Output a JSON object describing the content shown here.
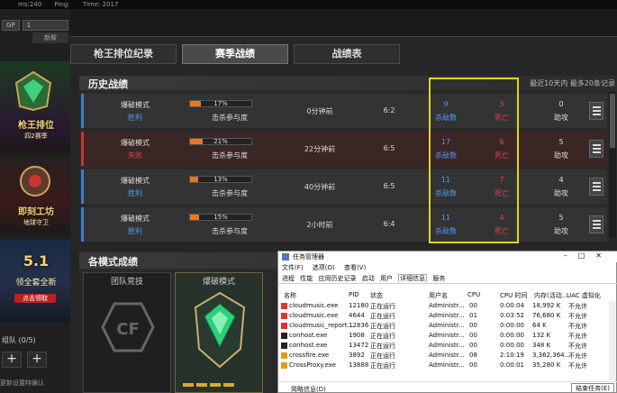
{
  "topbar": {
    "left": "ms:240",
    "ping": "Ping:",
    "time": "Time: 2017"
  },
  "left_sidebar": {
    "gp_label": "GP",
    "gp_value": "1",
    "new_button": "新叙",
    "promo1_title": "枪王排位",
    "promo1_sub": "四2赛季",
    "promo2_title": "即刻工坊",
    "promo2_sub": "地球守卫",
    "promo3_title": "5.1",
    "promo3_sub": "领全套全新",
    "promo3_btn": "点击领取",
    "squad_label": "组队 (0/5)",
    "plus": "+",
    "invite": "更新设置特确认"
  },
  "tabs": [
    {
      "label": "枪王排位纪录",
      "active": false
    },
    {
      "label": "赛季战绩",
      "active": true
    },
    {
      "label": "战绩表",
      "active": false
    }
  ],
  "history": {
    "title": "历史战绩",
    "note": "最近10天内 最多20条记录",
    "participation_label": "击杀参与度",
    "kills_label": "杀敌数",
    "deaths_label": "死亡",
    "assists_label": "助攻",
    "rows": [
      {
        "mode": "爆破模式",
        "result": "胜利",
        "win": true,
        "pct": "17%",
        "pct_value": 17,
        "time": "0分钟前",
        "score": "6:2",
        "kills": "9",
        "deaths": "3",
        "assists": "0"
      },
      {
        "mode": "爆破模式",
        "result": "失败",
        "win": false,
        "pct": "21%",
        "pct_value": 21,
        "time": "22分钟前",
        "score": "6:5",
        "kills": "17",
        "deaths": "6",
        "assists": "5"
      },
      {
        "mode": "爆破模式",
        "result": "胜利",
        "win": true,
        "pct": "13%",
        "pct_value": 13,
        "time": "40分钟前",
        "score": "6:5",
        "kills": "11",
        "deaths": "7",
        "assists": "4"
      },
      {
        "mode": "爆破模式",
        "result": "胜利",
        "win": true,
        "pct": "15%",
        "pct_value": 15,
        "time": "2小时前",
        "score": "6:4",
        "kills": "11",
        "deaths": "4",
        "assists": "5"
      }
    ]
  },
  "modes": {
    "title": "各模式成绩",
    "cards": [
      {
        "label": "团队竞技"
      },
      {
        "label": "爆破模式"
      }
    ]
  },
  "task_manager": {
    "title": "任务管理器",
    "menu": [
      "文件(F)",
      "选项(O)",
      "查看(V)"
    ],
    "tabs": [
      "进程",
      "性能",
      "应用历史记录",
      "启动",
      "用户",
      "详细信息",
      "服务"
    ],
    "active_tab": "详细信息",
    "columns": [
      "名称",
      "PID",
      "状态",
      "用户名",
      "CPU",
      "CPU 时间",
      "内存(活动...",
      "UAC 虚拟化"
    ],
    "rows": [
      {
        "name": "cloudmusic.exe",
        "pid": "12180",
        "status": "正在运行",
        "user": "Administr...",
        "cpu": "00",
        "cputime": "0:00:04",
        "mem": "18,992 K",
        "uac": "不允许",
        "icon": "music"
      },
      {
        "name": "cloudmusic.exe",
        "pid": "4644",
        "status": "正在运行",
        "user": "Administr...",
        "cpu": "01",
        "cputime": "0:03:52",
        "mem": "76,680 K",
        "uac": "不允许",
        "icon": "music"
      },
      {
        "name": "cloudmusic_report...",
        "pid": "12836",
        "status": "正在运行",
        "user": "Administr...",
        "cpu": "00",
        "cputime": "0:00:00",
        "mem": "64 K",
        "uac": "不允许",
        "icon": "music"
      },
      {
        "name": "conhost.exe",
        "pid": "1908",
        "status": "正在运行",
        "user": "Administr...",
        "cpu": "00",
        "cputime": "0:00:00",
        "mem": "132 K",
        "uac": "不允许",
        "icon": "cmd"
      },
      {
        "name": "conhost.exe",
        "pid": "13472",
        "status": "正在运行",
        "user": "Administr...",
        "cpu": "00",
        "cputime": "0:00:00",
        "mem": "348 K",
        "uac": "不允许",
        "icon": "cmd"
      },
      {
        "name": "crossfire.exe",
        "pid": "3892",
        "status": "正在运行",
        "user": "Administr...",
        "cpu": "08",
        "cputime": "2:10:19",
        "mem": "3,362,364...",
        "uac": "不允许",
        "icon": "cf"
      },
      {
        "name": "CrossProxy.exe",
        "pid": "13888",
        "status": "正在运行",
        "user": "Administr...",
        "cpu": "00",
        "cputime": "0:00:01",
        "mem": "35,280 K",
        "uac": "不允许",
        "icon": "cf"
      }
    ],
    "footer_left": "简略信息(D)",
    "footer_button": "结束任务(E)"
  }
}
